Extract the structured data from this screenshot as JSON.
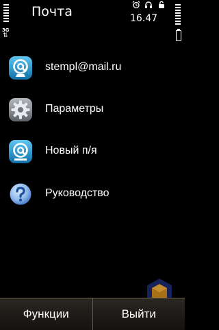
{
  "status": {
    "network_type": "3G",
    "title": "Почта",
    "time": "16.47"
  },
  "menu": [
    {
      "label": "stempl@mail.ru",
      "icon": "mailbox-icon"
    },
    {
      "label": "Параметры",
      "icon": "gear-icon"
    },
    {
      "label": "Новый п/я",
      "icon": "new-mailbox-icon"
    },
    {
      "label": "Руководство",
      "icon": "help-icon"
    }
  ],
  "softkeys": {
    "left": "Функции",
    "right": "Выйти"
  },
  "colors": {
    "background": "#000000",
    "mail_icon": "#1e9ad4",
    "gear_icon": "#8a8f96",
    "help_icon": "#4c8bd8",
    "softkey_bar": "#2a2622",
    "softkey_border": "#6b5a44"
  }
}
